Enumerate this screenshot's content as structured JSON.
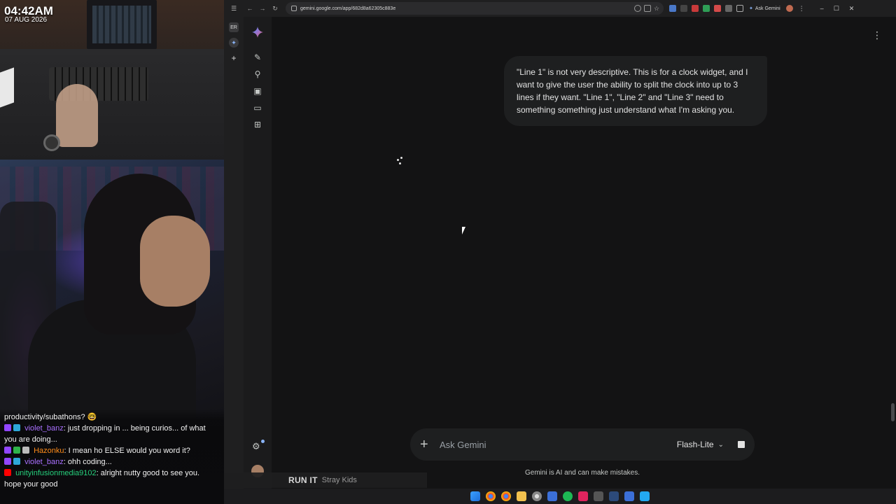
{
  "stream": {
    "clock_time": "04:42AM",
    "clock_date": "07 AUG 2026",
    "chat": [
      {
        "kind": "plain",
        "text": "productivity/subathons? 🤓"
      },
      {
        "kind": "msg",
        "user": "violet_banz",
        "message": ": just dropping in ... being curios... of what",
        "cont": "you are doing..."
      },
      {
        "kind": "msg",
        "user": "Hazonku",
        "message": ": I mean ho ELSE would you word it?"
      },
      {
        "kind": "msg",
        "user": "violet_banz",
        "message": ": ohh coding..."
      },
      {
        "kind": "msg",
        "user": "unityinfusionmedia9102",
        "message": ": alright nutty good to see you.",
        "cont": "hope your good"
      }
    ]
  },
  "browser": {
    "url": "gemini.google.com/app/682d8a62305c883e",
    "ask_gemini_label": "Ask Gemini",
    "nav_icons": [
      "back-icon",
      "forward-icon",
      "reload-icon"
    ],
    "window_controls": [
      "minimize-icon",
      "maximize-icon",
      "close-icon"
    ]
  },
  "gemini": {
    "user_message": "\"Line 1\" is not very descriptive. This is for a clock widget, and I want to give the user the ability to split the clock into up to 3 lines if they want. \"Line 1\", \"Line 2\" and \"Line 3\" need to something something just understand what I'm asking you.",
    "input_placeholder": "Ask Gemini",
    "model_label": "Flash-Lite",
    "disclaimer": "Gemini is AI and can make mistakes.",
    "sidebar_icons": [
      "new-chat-icon",
      "search-icon",
      "library-icon",
      "gems-icon",
      "apps-icon"
    ]
  },
  "music": {
    "song": "RUN IT",
    "artist": "Stray Kids"
  },
  "colors": {
    "background": "#131314",
    "bubble": "#1e1f20",
    "twitch": "#9146ff",
    "accent_blue": "#8ab4f8"
  }
}
